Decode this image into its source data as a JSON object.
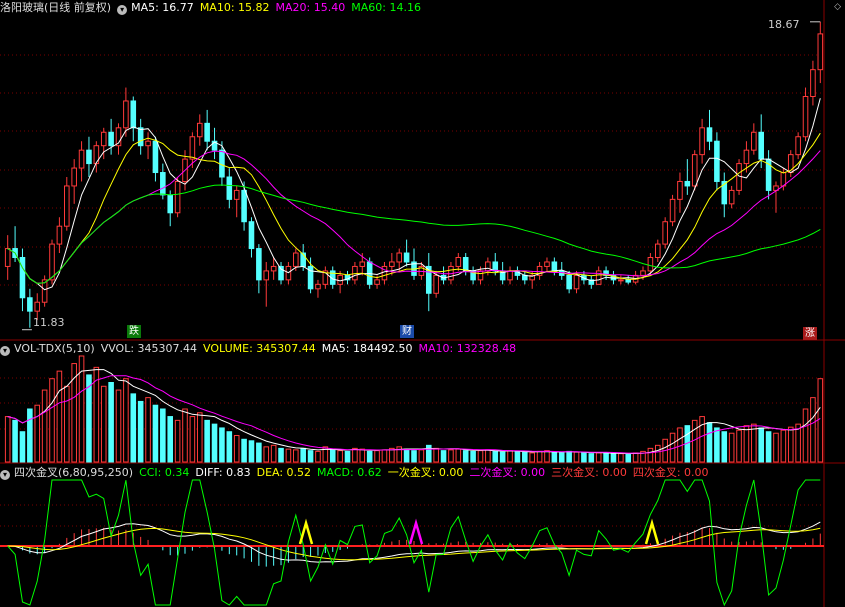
{
  "header_main": {
    "title": "洛阳玻璃(日线 前复权)",
    "ma5": "MA5: 16.77",
    "ma10": "MA10: 15.82",
    "ma20": "MA20: 15.40",
    "ma60": "MA60: 14.16"
  },
  "header_vol": {
    "name": "VOL-TDX(5,10)",
    "vvol": "VVOL: 345307.44",
    "volume": "VOLUME: 345307.44",
    "ma5": "MA5: 184492.50",
    "ma10": "MA10: 132328.48"
  },
  "header_ind": {
    "name": "四次金叉(6,80,95,250)",
    "cci": "CCI: 0.34",
    "diff": "DIFF: 0.83",
    "dea": "DEA: 0.52",
    "macd": "MACD: 0.62",
    "g1": "一次金叉: 0.00",
    "g2": "二次金叉: 0.00",
    "g3": "三次金叉: 0.00",
    "g4": "四次金叉: 0.00"
  },
  "labels": {
    "high": "18.67",
    "low": "11.83",
    "event_down": "跌",
    "event_fin": "财",
    "event_up": "涨"
  },
  "colors": {
    "up": "#ff3a3a",
    "down": "#54ffff",
    "ma5": "#ffffff",
    "ma10": "#ffff00",
    "ma20": "#ff00ff",
    "ma60": "#00ff00",
    "grid": "#7a0000"
  },
  "chart_data": {
    "type": "candlestick",
    "price_range": [
      11.6,
      18.8
    ],
    "candles": [
      [
        13.2,
        13.9,
        12.9,
        13.6
      ],
      [
        13.6,
        14.1,
        13.3,
        13.4
      ],
      [
        13.4,
        13.6,
        12.2,
        12.5
      ],
      [
        12.5,
        12.7,
        11.83,
        12.2
      ],
      [
        12.2,
        12.6,
        12.0,
        12.4
      ],
      [
        12.4,
        13.0,
        12.3,
        12.9
      ],
      [
        12.9,
        13.8,
        12.8,
        13.7
      ],
      [
        13.7,
        14.3,
        13.5,
        14.1
      ],
      [
        14.1,
        15.2,
        14.0,
        15.0
      ],
      [
        15.0,
        15.6,
        14.6,
        15.4
      ],
      [
        15.4,
        16.0,
        15.1,
        15.8
      ],
      [
        15.8,
        16.1,
        15.2,
        15.5
      ],
      [
        15.5,
        16.0,
        15.3,
        15.9
      ],
      [
        15.9,
        16.3,
        15.6,
        16.2
      ],
      [
        16.2,
        16.5,
        15.7,
        15.9
      ],
      [
        15.9,
        16.4,
        15.7,
        16.3
      ],
      [
        16.3,
        17.2,
        16.1,
        16.9
      ],
      [
        16.9,
        17.0,
        16.0,
        16.3
      ],
      [
        16.3,
        16.5,
        15.7,
        15.9
      ],
      [
        15.9,
        16.2,
        15.6,
        16.0
      ],
      [
        16.0,
        16.1,
        15.1,
        15.3
      ],
      [
        15.3,
        15.5,
        14.7,
        14.8
      ],
      [
        14.8,
        14.9,
        14.1,
        14.4
      ],
      [
        14.4,
        15.2,
        14.3,
        15.1
      ],
      [
        15.1,
        15.8,
        14.9,
        15.6
      ],
      [
        15.6,
        16.2,
        15.4,
        16.1
      ],
      [
        16.1,
        16.6,
        15.9,
        16.4
      ],
      [
        16.4,
        16.7,
        15.8,
        16.0
      ],
      [
        16.0,
        16.3,
        15.6,
        15.8
      ],
      [
        15.8,
        16.0,
        15.0,
        15.2
      ],
      [
        15.2,
        15.4,
        14.5,
        14.7
      ],
      [
        14.7,
        15.0,
        14.3,
        14.9
      ],
      [
        14.9,
        15.1,
        14.0,
        14.2
      ],
      [
        14.2,
        14.3,
        13.4,
        13.6
      ],
      [
        13.6,
        13.7,
        12.6,
        12.9
      ],
      [
        12.9,
        13.3,
        12.3,
        13.1
      ],
      [
        13.1,
        13.4,
        12.9,
        13.2
      ],
      [
        13.2,
        13.3,
        12.8,
        12.9
      ],
      [
        12.9,
        13.3,
        12.8,
        13.2
      ],
      [
        13.2,
        13.6,
        13.1,
        13.5
      ],
      [
        13.5,
        13.7,
        13.1,
        13.2
      ],
      [
        13.2,
        13.4,
        12.6,
        12.7
      ],
      [
        12.7,
        12.9,
        12.5,
        12.8
      ],
      [
        12.8,
        13.2,
        12.7,
        13.1
      ],
      [
        13.1,
        13.2,
        12.7,
        12.8
      ],
      [
        12.8,
        13.1,
        12.6,
        13.0
      ],
      [
        13.0,
        13.1,
        12.8,
        12.9
      ],
      [
        12.9,
        13.3,
        12.8,
        13.2
      ],
      [
        13.2,
        13.5,
        13.0,
        13.3
      ],
      [
        13.3,
        13.4,
        12.7,
        12.8
      ],
      [
        12.8,
        13.0,
        12.7,
        12.9
      ],
      [
        12.9,
        13.3,
        12.8,
        13.2
      ],
      [
        13.2,
        13.5,
        13.0,
        13.3
      ],
      [
        13.3,
        13.6,
        13.1,
        13.5
      ],
      [
        13.5,
        13.8,
        13.2,
        13.3
      ],
      [
        13.3,
        13.6,
        12.9,
        13.0
      ],
      [
        13.0,
        13.3,
        12.9,
        13.2
      ],
      [
        13.2,
        13.5,
        12.2,
        12.6
      ],
      [
        12.6,
        13.1,
        12.5,
        13.0
      ],
      [
        13.0,
        13.2,
        12.8,
        12.9
      ],
      [
        12.9,
        13.3,
        12.8,
        13.2
      ],
      [
        13.2,
        13.5,
        13.1,
        13.4
      ],
      [
        13.4,
        13.5,
        13.0,
        13.1
      ],
      [
        13.1,
        13.2,
        12.8,
        12.9
      ],
      [
        12.9,
        13.2,
        12.8,
        13.1
      ],
      [
        13.1,
        13.4,
        13.0,
        13.3
      ],
      [
        13.3,
        13.5,
        13.0,
        13.1
      ],
      [
        13.1,
        13.3,
        12.8,
        12.9
      ],
      [
        12.9,
        13.2,
        12.8,
        13.1
      ],
      [
        13.1,
        13.2,
        12.9,
        13.0
      ],
      [
        13.0,
        13.1,
        12.8,
        12.9
      ],
      [
        12.9,
        13.1,
        12.7,
        13.0
      ],
      [
        13.0,
        13.3,
        12.9,
        13.2
      ],
      [
        13.2,
        13.4,
        13.1,
        13.3
      ],
      [
        13.3,
        13.4,
        13.0,
        13.1
      ],
      [
        13.1,
        13.3,
        12.9,
        13.0
      ],
      [
        13.0,
        13.1,
        12.6,
        12.7
      ],
      [
        12.7,
        13.1,
        12.6,
        13.0
      ],
      [
        13.0,
        13.1,
        12.8,
        12.9
      ],
      [
        12.9,
        13.0,
        12.7,
        12.8
      ],
      [
        12.8,
        13.2,
        12.8,
        13.1
      ],
      [
        13.1,
        13.2,
        12.9,
        13.0
      ],
      [
        13.0,
        13.1,
        12.8,
        12.9
      ],
      [
        12.9,
        13.0,
        12.8,
        12.9
      ],
      [
        12.9,
        13.0,
        12.8,
        12.85
      ],
      [
        12.85,
        13.1,
        12.8,
        13.0
      ],
      [
        13.0,
        13.2,
        12.9,
        13.1
      ],
      [
        13.1,
        13.5,
        13.0,
        13.4
      ],
      [
        13.4,
        13.8,
        13.3,
        13.7
      ],
      [
        13.7,
        14.3,
        13.6,
        14.2
      ],
      [
        14.2,
        14.8,
        14.1,
        14.7
      ],
      [
        14.7,
        15.3,
        14.4,
        15.1
      ],
      [
        15.1,
        15.6,
        14.8,
        15.0
      ],
      [
        15.0,
        15.8,
        14.9,
        15.7
      ],
      [
        15.7,
        16.5,
        15.5,
        16.3
      ],
      [
        16.3,
        16.7,
        15.8,
        16.0
      ],
      [
        16.0,
        16.2,
        14.9,
        15.1
      ],
      [
        15.1,
        15.3,
        14.3,
        14.6
      ],
      [
        14.6,
        15.0,
        14.5,
        14.9
      ],
      [
        14.9,
        15.6,
        14.8,
        15.5
      ],
      [
        15.5,
        16.0,
        15.3,
        15.8
      ],
      [
        15.8,
        16.4,
        15.7,
        16.2
      ],
      [
        16.2,
        16.6,
        15.4,
        15.6
      ],
      [
        15.6,
        15.8,
        14.7,
        14.9
      ],
      [
        14.9,
        15.1,
        14.4,
        15.0
      ],
      [
        15.0,
        15.4,
        14.9,
        15.3
      ],
      [
        15.3,
        15.8,
        15.2,
        15.7
      ],
      [
        15.7,
        16.2,
        15.6,
        16.1
      ],
      [
        16.1,
        17.2,
        16.0,
        17.0
      ],
      [
        17.0,
        17.8,
        16.8,
        17.6
      ],
      [
        17.6,
        18.67,
        17.3,
        18.4
      ]
    ],
    "volume": [
      60,
      55,
      40,
      70,
      75,
      95,
      110,
      120,
      100,
      130,
      140,
      115,
      125,
      100,
      105,
      95,
      110,
      90,
      80,
      85,
      75,
      70,
      60,
      55,
      70,
      60,
      65,
      55,
      50,
      45,
      40,
      35,
      30,
      28,
      25,
      20,
      22,
      18,
      17,
      16,
      18,
      15,
      14,
      20,
      16,
      15,
      14,
      18,
      17,
      14,
      15,
      16,
      18,
      20,
      17,
      15,
      16,
      22,
      18,
      15,
      16,
      17,
      15,
      14,
      15,
      16,
      14,
      13,
      15,
      14,
      13,
      12,
      14,
      15,
      13,
      12,
      14,
      13,
      12,
      11,
      12,
      12,
      11,
      11,
      10,
      12,
      14,
      18,
      22,
      30,
      38,
      45,
      48,
      55,
      60,
      52,
      45,
      40,
      38,
      42,
      48,
      50,
      45,
      40,
      38,
      42,
      46,
      50,
      70,
      85,
      110
    ],
    "annotations": {
      "high": 18.67,
      "low": 11.83
    }
  }
}
